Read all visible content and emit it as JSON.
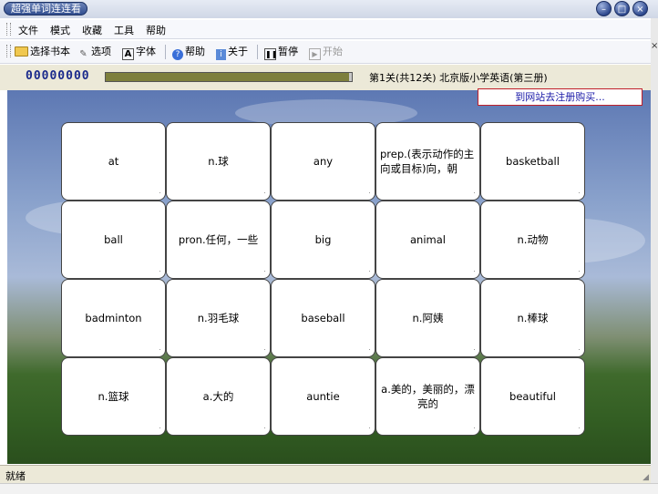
{
  "window": {
    "title": "超强单词连连看",
    "buttons": [
      "minimize",
      "maximize",
      "close"
    ]
  },
  "menu": {
    "items": [
      "文件",
      "模式",
      "收藏",
      "工具",
      "帮助"
    ]
  },
  "toolbar": {
    "items": [
      {
        "label": "选择书本",
        "icon": "folder-open-icon",
        "enabled": true
      },
      {
        "label": "选项",
        "icon": "wrench-icon",
        "enabled": true
      },
      {
        "label": "字体",
        "icon": "font-icon",
        "enabled": true
      },
      {
        "label": "帮助",
        "icon": "help-icon",
        "enabled": true
      },
      {
        "label": "关于",
        "icon": "about-icon",
        "enabled": true
      },
      {
        "label": "暂停",
        "icon": "pause-icon",
        "enabled": true
      },
      {
        "label": "开始",
        "icon": "play-icon",
        "enabled": false
      }
    ]
  },
  "game": {
    "score": "00000000",
    "time_progress": 0.99,
    "level_text": "第1关(共12关) 北京版小学英语(第三册)",
    "buy_link": "到网站去注册购买...",
    "cards": [
      [
        "at",
        "n.球",
        "any",
        "prep.(表示动作的主向或目标)向，朝",
        "basketball"
      ],
      [
        "ball",
        "pron.任何，一些",
        "big",
        "animal",
        "n.动物"
      ],
      [
        "badminton",
        "n.羽毛球",
        "baseball",
        "n.阿姨",
        "n.棒球"
      ],
      [
        "n.篮球",
        "a.大的",
        "auntie",
        "a.美的，美丽的，漂亮的",
        "beautiful"
      ]
    ]
  },
  "status": {
    "text": "就绪"
  },
  "colors": {
    "title_pill": "#2d4a8c",
    "score": "#1a2a8c",
    "progress_fill": "#7d7f3c",
    "buy_border": "#c0202a",
    "buy_text": "#1a1aa8"
  }
}
